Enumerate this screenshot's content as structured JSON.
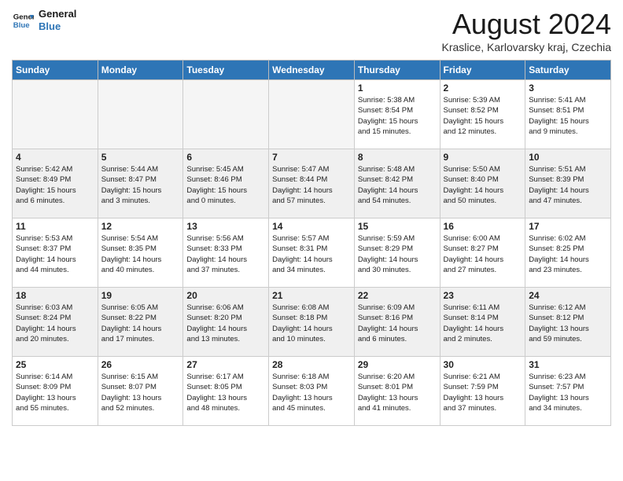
{
  "logo": {
    "line1": "General",
    "line2": "Blue"
  },
  "title": "August 2024",
  "location": "Kraslice, Karlovarsky kraj, Czechia",
  "days_of_week": [
    "Sunday",
    "Monday",
    "Tuesday",
    "Wednesday",
    "Thursday",
    "Friday",
    "Saturday"
  ],
  "weeks": [
    [
      {
        "day": "",
        "info": ""
      },
      {
        "day": "",
        "info": ""
      },
      {
        "day": "",
        "info": ""
      },
      {
        "day": "",
        "info": ""
      },
      {
        "day": "1",
        "info": "Sunrise: 5:38 AM\nSunset: 8:54 PM\nDaylight: 15 hours\nand 15 minutes."
      },
      {
        "day": "2",
        "info": "Sunrise: 5:39 AM\nSunset: 8:52 PM\nDaylight: 15 hours\nand 12 minutes."
      },
      {
        "day": "3",
        "info": "Sunrise: 5:41 AM\nSunset: 8:51 PM\nDaylight: 15 hours\nand 9 minutes."
      }
    ],
    [
      {
        "day": "4",
        "info": "Sunrise: 5:42 AM\nSunset: 8:49 PM\nDaylight: 15 hours\nand 6 minutes."
      },
      {
        "day": "5",
        "info": "Sunrise: 5:44 AM\nSunset: 8:47 PM\nDaylight: 15 hours\nand 3 minutes."
      },
      {
        "day": "6",
        "info": "Sunrise: 5:45 AM\nSunset: 8:46 PM\nDaylight: 15 hours\nand 0 minutes."
      },
      {
        "day": "7",
        "info": "Sunrise: 5:47 AM\nSunset: 8:44 PM\nDaylight: 14 hours\nand 57 minutes."
      },
      {
        "day": "8",
        "info": "Sunrise: 5:48 AM\nSunset: 8:42 PM\nDaylight: 14 hours\nand 54 minutes."
      },
      {
        "day": "9",
        "info": "Sunrise: 5:50 AM\nSunset: 8:40 PM\nDaylight: 14 hours\nand 50 minutes."
      },
      {
        "day": "10",
        "info": "Sunrise: 5:51 AM\nSunset: 8:39 PM\nDaylight: 14 hours\nand 47 minutes."
      }
    ],
    [
      {
        "day": "11",
        "info": "Sunrise: 5:53 AM\nSunset: 8:37 PM\nDaylight: 14 hours\nand 44 minutes."
      },
      {
        "day": "12",
        "info": "Sunrise: 5:54 AM\nSunset: 8:35 PM\nDaylight: 14 hours\nand 40 minutes."
      },
      {
        "day": "13",
        "info": "Sunrise: 5:56 AM\nSunset: 8:33 PM\nDaylight: 14 hours\nand 37 minutes."
      },
      {
        "day": "14",
        "info": "Sunrise: 5:57 AM\nSunset: 8:31 PM\nDaylight: 14 hours\nand 34 minutes."
      },
      {
        "day": "15",
        "info": "Sunrise: 5:59 AM\nSunset: 8:29 PM\nDaylight: 14 hours\nand 30 minutes."
      },
      {
        "day": "16",
        "info": "Sunrise: 6:00 AM\nSunset: 8:27 PM\nDaylight: 14 hours\nand 27 minutes."
      },
      {
        "day": "17",
        "info": "Sunrise: 6:02 AM\nSunset: 8:25 PM\nDaylight: 14 hours\nand 23 minutes."
      }
    ],
    [
      {
        "day": "18",
        "info": "Sunrise: 6:03 AM\nSunset: 8:24 PM\nDaylight: 14 hours\nand 20 minutes."
      },
      {
        "day": "19",
        "info": "Sunrise: 6:05 AM\nSunset: 8:22 PM\nDaylight: 14 hours\nand 17 minutes."
      },
      {
        "day": "20",
        "info": "Sunrise: 6:06 AM\nSunset: 8:20 PM\nDaylight: 14 hours\nand 13 minutes."
      },
      {
        "day": "21",
        "info": "Sunrise: 6:08 AM\nSunset: 8:18 PM\nDaylight: 14 hours\nand 10 minutes."
      },
      {
        "day": "22",
        "info": "Sunrise: 6:09 AM\nSunset: 8:16 PM\nDaylight: 14 hours\nand 6 minutes."
      },
      {
        "day": "23",
        "info": "Sunrise: 6:11 AM\nSunset: 8:14 PM\nDaylight: 14 hours\nand 2 minutes."
      },
      {
        "day": "24",
        "info": "Sunrise: 6:12 AM\nSunset: 8:12 PM\nDaylight: 13 hours\nand 59 minutes."
      }
    ],
    [
      {
        "day": "25",
        "info": "Sunrise: 6:14 AM\nSunset: 8:09 PM\nDaylight: 13 hours\nand 55 minutes."
      },
      {
        "day": "26",
        "info": "Sunrise: 6:15 AM\nSunset: 8:07 PM\nDaylight: 13 hours\nand 52 minutes."
      },
      {
        "day": "27",
        "info": "Sunrise: 6:17 AM\nSunset: 8:05 PM\nDaylight: 13 hours\nand 48 minutes."
      },
      {
        "day": "28",
        "info": "Sunrise: 6:18 AM\nSunset: 8:03 PM\nDaylight: 13 hours\nand 45 minutes."
      },
      {
        "day": "29",
        "info": "Sunrise: 6:20 AM\nSunset: 8:01 PM\nDaylight: 13 hours\nand 41 minutes."
      },
      {
        "day": "30",
        "info": "Sunrise: 6:21 AM\nSunset: 7:59 PM\nDaylight: 13 hours\nand 37 minutes."
      },
      {
        "day": "31",
        "info": "Sunrise: 6:23 AM\nSunset: 7:57 PM\nDaylight: 13 hours\nand 34 minutes."
      }
    ]
  ]
}
